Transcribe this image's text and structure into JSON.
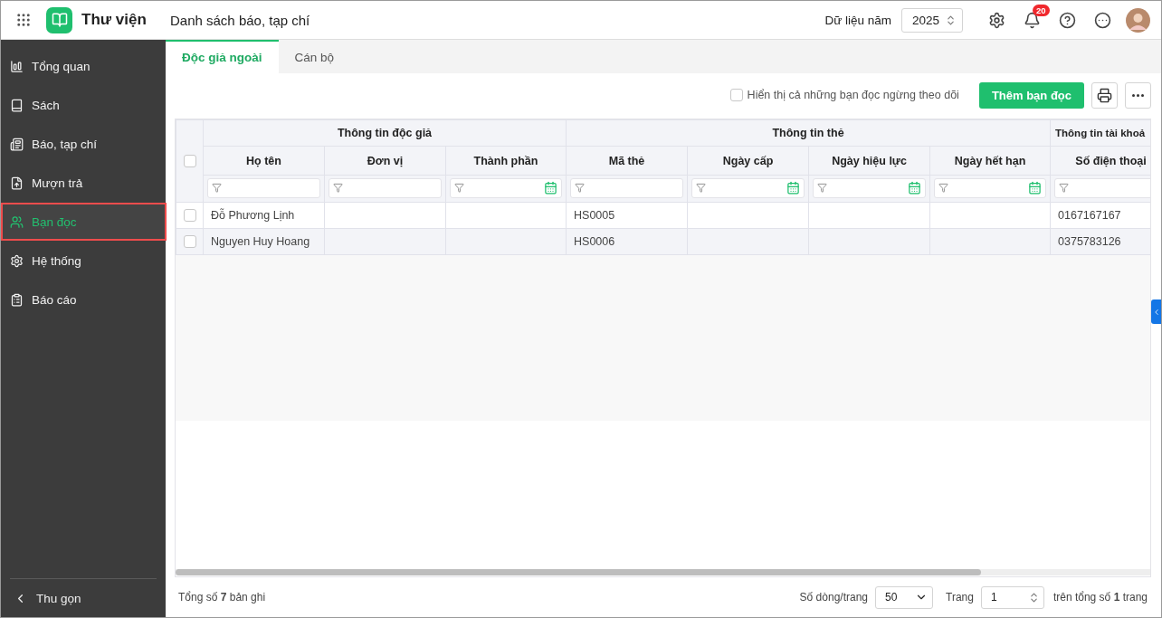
{
  "app": {
    "title": "Thư viện",
    "page_title": "Danh sách báo, tạp chí"
  },
  "topbar": {
    "year_label": "Dữ liệu năm",
    "year": "2025",
    "notifications": "20"
  },
  "sidebar": {
    "items": [
      {
        "label": "Tổng quan",
        "selected": false
      },
      {
        "label": "Sách",
        "selected": false
      },
      {
        "label": "Báo, tạp chí",
        "selected": false
      },
      {
        "label": "Mượn trả",
        "selected": false
      },
      {
        "label": "Bạn đọc",
        "selected": true
      },
      {
        "label": "Hệ thống",
        "selected": false
      },
      {
        "label": "Báo cáo",
        "selected": false
      }
    ],
    "collapse": "Thu gọn"
  },
  "tabs": [
    {
      "label": "Độc giả ngoài",
      "selected": true
    },
    {
      "label": "Cán bộ",
      "selected": false
    }
  ],
  "toolbar": {
    "show_inactive": {
      "label": "Hiển thị cả những bạn đọc ngừng theo dõi",
      "checked": false
    },
    "add_button": "Thêm bạn đọc"
  },
  "table": {
    "groups": [
      {
        "label": "Thông tin độc giả",
        "columns": [
          {
            "label": "Họ tên",
            "kind": "text"
          },
          {
            "label": "Đơn vị",
            "kind": "text"
          },
          {
            "label": "Thành phần",
            "kind": "date"
          }
        ]
      },
      {
        "label": "Thông tin thẻ",
        "columns": [
          {
            "label": "Mã thẻ",
            "kind": "text"
          },
          {
            "label": "Ngày cấp",
            "kind": "date"
          },
          {
            "label": "Ngày hiệu lực",
            "kind": "date"
          },
          {
            "label": "Ngày hết hạn",
            "kind": "date"
          }
        ]
      },
      {
        "label": "Thông tin tài khoả",
        "columns": [
          {
            "label": "Số điện thoại",
            "kind": "text"
          }
        ]
      }
    ],
    "select_all_checked": false,
    "rows": [
      {
        "checked": false,
        "cells": [
          "Đỗ Phương Lịnh",
          null,
          null,
          "HS0005",
          null,
          null,
          null,
          "0167167167"
        ]
      },
      {
        "checked": false,
        "cells": [
          "Nguyen Huy Hoang",
          null,
          null,
          "HS0006",
          null,
          null,
          null,
          "0375783126"
        ]
      }
    ]
  },
  "footer": {
    "total": "Tổng số **7** bản ghi",
    "page_size_label": "Số dòng/trang",
    "page_size": "50",
    "page_label": "Trang",
    "page": "1",
    "page_total": "trên tổng số **1** trang"
  }
}
